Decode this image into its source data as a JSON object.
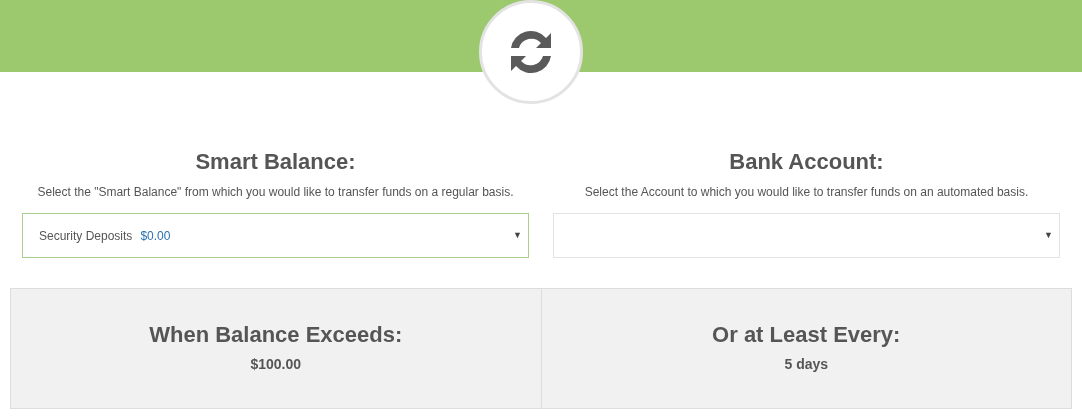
{
  "selectors": [
    {
      "title": "Smart Balance:",
      "description": "Select the \"Smart Balance\" from which you would like to transfer funds on a regular basis.",
      "value": {
        "name": "Security Deposits",
        "amount": "$0.00"
      },
      "focused": true,
      "arrow": "▼"
    },
    {
      "title": "Bank Account:",
      "description": "Select the Account to which you would like to transfer funds on an automated basis.",
      "focused": false,
      "arrow": "▼"
    }
  ],
  "rules": [
    {
      "label": "When Balance Exceeds:",
      "value": "$100.00"
    },
    {
      "label": "Or at Least Every:",
      "value": "5 days"
    }
  ]
}
